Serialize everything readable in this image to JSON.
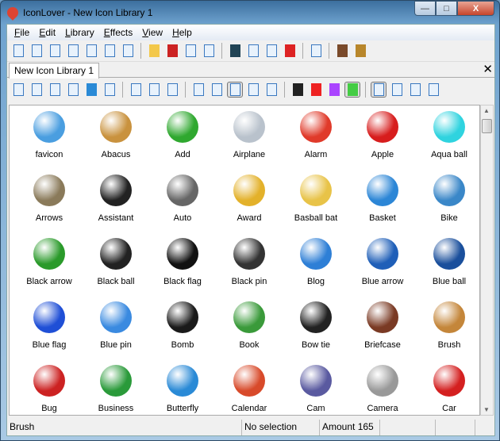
{
  "window": {
    "title": "IconLover - New Icon Library 1",
    "minimize": "—",
    "maximize": "□",
    "close": "X"
  },
  "menu": [
    {
      "label": "File",
      "key": "F",
      "rest": "ile"
    },
    {
      "label": "Edit",
      "key": "E",
      "rest": "dit"
    },
    {
      "label": "Library",
      "key": "L",
      "rest": "ibrary"
    },
    {
      "label": "Effects",
      "key": "E",
      "rest": "ffects"
    },
    {
      "label": "View",
      "key": "V",
      "rest": "iew"
    },
    {
      "label": "Help",
      "key": "H",
      "rest": "elp"
    }
  ],
  "tab": {
    "label": "New Icon Library 1",
    "close": "✕"
  },
  "icons": [
    {
      "label": "favicon",
      "color": "#4a9ee0"
    },
    {
      "label": "Abacus",
      "color": "#c9923e"
    },
    {
      "label": "Add",
      "color": "#2fa82f"
    },
    {
      "label": "Airplane",
      "color": "#b9c2cc"
    },
    {
      "label": "Alarm",
      "color": "#e03a2a"
    },
    {
      "label": "Apple",
      "color": "#d71d1d"
    },
    {
      "label": "Aqua ball",
      "color": "#2fd3df"
    },
    {
      "label": "Arrows",
      "color": "#8a7a5a"
    },
    {
      "label": "Assistant",
      "color": "#222"
    },
    {
      "label": "Auto",
      "color": "#666"
    },
    {
      "label": "Award",
      "color": "#e3b12a"
    },
    {
      "label": "Basball bat",
      "color": "#e8c348"
    },
    {
      "label": "Basket",
      "color": "#2c86d6"
    },
    {
      "label": "Bike",
      "color": "#3a87c8"
    },
    {
      "label": "Black arrow",
      "color": "#2a9a2a"
    },
    {
      "label": "Black ball",
      "color": "#222"
    },
    {
      "label": "Black flag",
      "color": "#111"
    },
    {
      "label": "Black pin",
      "color": "#333"
    },
    {
      "label": "Blog",
      "color": "#2e7fd6"
    },
    {
      "label": "Blue arrow",
      "color": "#1f5fb8"
    },
    {
      "label": "Blue ball",
      "color": "#1a4f9c"
    },
    {
      "label": "Blue flag",
      "color": "#1f4fd6"
    },
    {
      "label": "Blue pin",
      "color": "#3a8ae0"
    },
    {
      "label": "Bomb",
      "color": "#1a1a1a"
    },
    {
      "label": "Book",
      "color": "#3a9a3a"
    },
    {
      "label": "Bow tie",
      "color": "#222"
    },
    {
      "label": "Briefcase",
      "color": "#7a3a24"
    },
    {
      "label": "Brush",
      "color": "#c4863a"
    },
    {
      "label": "Bug",
      "color": "#cc2222"
    },
    {
      "label": "Business",
      "color": "#2a9a3a"
    },
    {
      "label": "Butterfly",
      "color": "#2a8ad6"
    },
    {
      "label": "Calendar",
      "color": "#d84a2a"
    },
    {
      "label": "Cam",
      "color": "#5a5aa0"
    },
    {
      "label": "Camera",
      "color": "#999"
    },
    {
      "label": "Car",
      "color": "#d42020"
    }
  ],
  "status": {
    "item": "Brush",
    "selection": "No selection",
    "amount": "Amount 165"
  }
}
